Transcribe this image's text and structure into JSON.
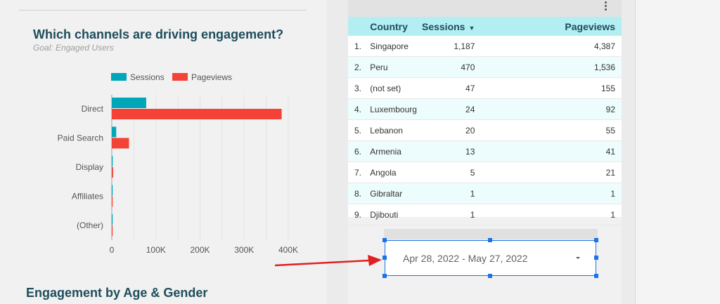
{
  "channels_chart": {
    "title": "Which channels are driving engagement?",
    "subtitle": "Goal: Engaged Users",
    "colors": {
      "sessions": "#00a7b8",
      "pageviews": "#f44336"
    }
  },
  "chart_data": {
    "type": "bar",
    "orientation": "horizontal",
    "categories": [
      "Direct",
      "Paid Search",
      "Display",
      "Affiliates",
      "(Other)"
    ],
    "series": [
      {
        "name": "Sessions",
        "values": [
          78000,
          10000,
          2000,
          300,
          200
        ]
      },
      {
        "name": "Pageviews",
        "values": [
          385000,
          39000,
          3000,
          500,
          400
        ]
      }
    ],
    "xlim": [
      0,
      400000
    ],
    "xticks": [
      0,
      100000,
      200000,
      300000,
      400000
    ],
    "xtick_labels": [
      "0",
      "100K",
      "200K",
      "300K",
      "400K"
    ],
    "legend_position": "top",
    "grid": true
  },
  "engagement_section": {
    "title": "Engagement by Age & Gender"
  },
  "country_table": {
    "columns": {
      "country": "Country",
      "sessions": "Sessions",
      "pageviews": "Pageviews"
    },
    "sort_indicator": "▼",
    "rows": [
      {
        "idx": "1.",
        "country": "Singapore",
        "sessions": "1,187",
        "pageviews": "4,387"
      },
      {
        "idx": "2.",
        "country": "Peru",
        "sessions": "470",
        "pageviews": "1,536"
      },
      {
        "idx": "3.",
        "country": "(not set)",
        "sessions": "47",
        "pageviews": "155"
      },
      {
        "idx": "4.",
        "country": "Luxembourg",
        "sessions": "24",
        "pageviews": "92"
      },
      {
        "idx": "5.",
        "country": "Lebanon",
        "sessions": "20",
        "pageviews": "55"
      },
      {
        "idx": "6.",
        "country": "Armenia",
        "sessions": "13",
        "pageviews": "41"
      },
      {
        "idx": "7.",
        "country": "Angola",
        "sessions": "5",
        "pageviews": "21"
      },
      {
        "idx": "8.",
        "country": "Gibraltar",
        "sessions": "1",
        "pageviews": "1"
      },
      {
        "idx": "9.",
        "country": "Djibouti",
        "sessions": "1",
        "pageviews": "1"
      }
    ]
  },
  "date_range": {
    "value": "Apr 28, 2022 - May 27, 2022"
  },
  "annotation": {
    "arrow_color": "#e02020"
  },
  "icons": {
    "more": "more-vert-icon",
    "dropdown": "dropdown-arrow-icon"
  }
}
